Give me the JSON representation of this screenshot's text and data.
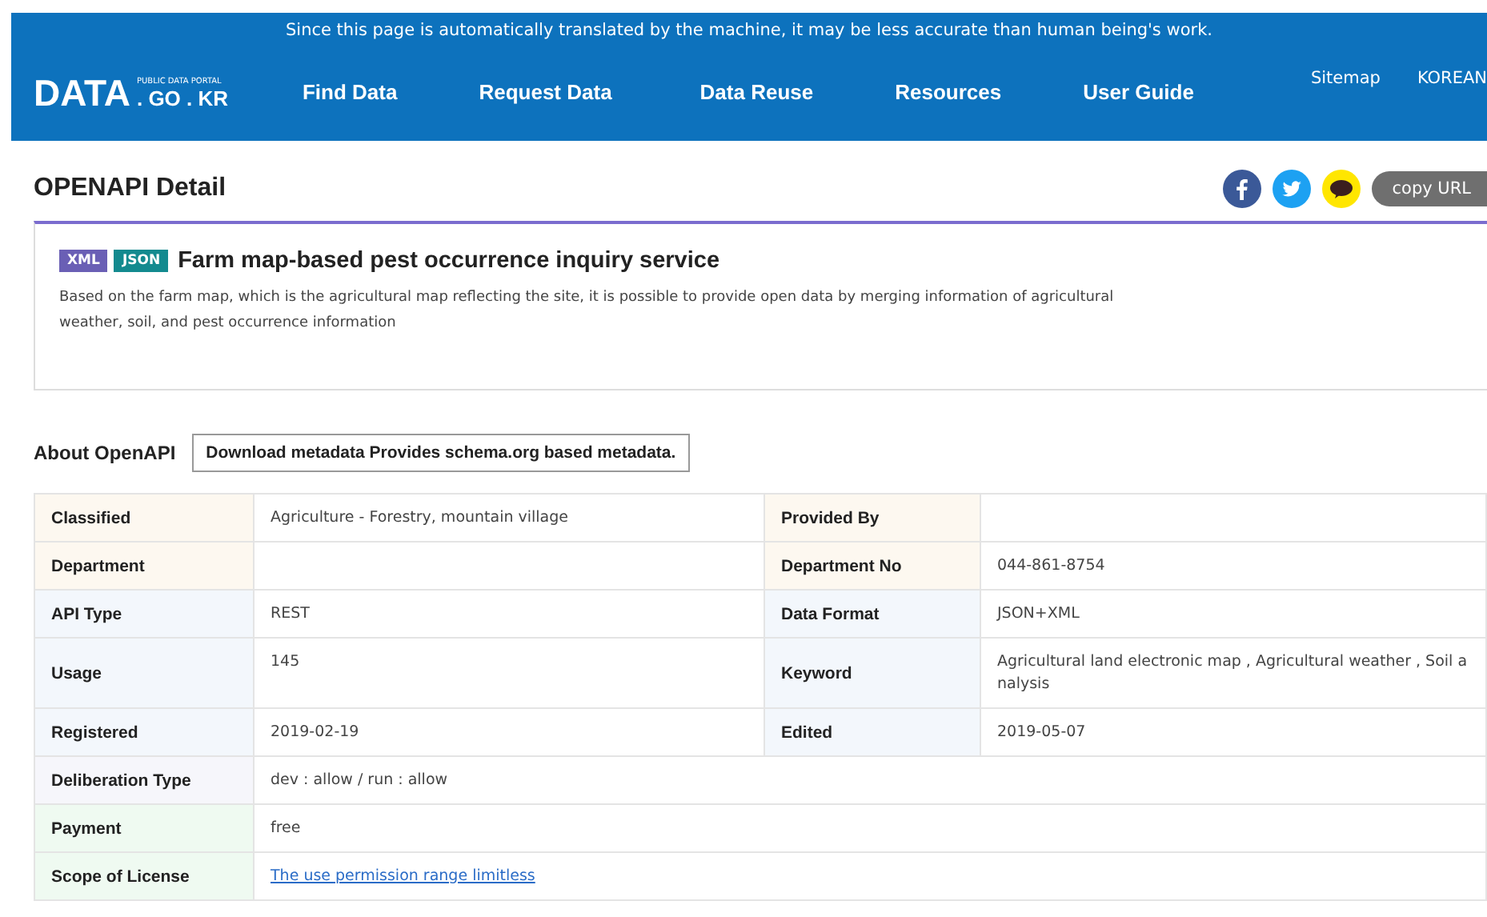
{
  "header": {
    "notice": "Since this page is automatically translated by the machine, it may be less accurate than human being's work.",
    "logo": {
      "main": "DATA",
      "sub": "PUBLIC DATA PORTAL",
      "domain": ". GO . KR"
    },
    "nav": [
      "Find Data",
      "Request Data",
      "Data Reuse",
      "Resources",
      "User Guide"
    ],
    "utility": [
      "Sitemap",
      "KOREAN"
    ]
  },
  "page_title": "OPENAPI Detail",
  "share": {
    "copy_label": "copy URL"
  },
  "service": {
    "formats": [
      {
        "label": "XML",
        "color": "#6a5fb5"
      },
      {
        "label": "JSON",
        "color": "#138a8f"
      }
    ],
    "title": "Farm map-based pest occurrence inquiry service",
    "description": "Based on the farm map, which is the agricultural map reflecting the site, it is possible to provide open data by merging information of agricultural weather, soil, and pest occurrence information"
  },
  "about": {
    "title": "About OpenAPI",
    "metadata_button": "Download metadata Provides schema.org based metadata."
  },
  "table": {
    "rows": [
      {
        "color": "#fdf8f0",
        "cells": [
          {
            "label": "Classified",
            "value": "Agriculture - Forestry, mountain village"
          },
          {
            "label": "Provided By"
          }
        ]
      },
      {
        "color": "#fdf8f0",
        "cells": [
          {
            "label": "Department"
          },
          {
            "label": "Department No",
            "value": "044-861-8754"
          }
        ]
      },
      {
        "color": "#f3f7fc",
        "cells": [
          {
            "label": "API Type",
            "value": "REST"
          },
          {
            "label": "Data Format",
            "value": "JSON+XML"
          }
        ]
      },
      {
        "color": "#f3f7fc",
        "tall": true,
        "cells": [
          {
            "label": "Usage",
            "value": "145"
          },
          {
            "label": "Keyword",
            "value": "Agricultural land electronic map , Agricultural weather , Soil a nalysis"
          }
        ]
      },
      {
        "color": "#f3f7fc",
        "cells": [
          {
            "label": "Registered",
            "value": "2019-02-19"
          },
          {
            "label": "Edited",
            "value": "2019-05-07"
          }
        ]
      },
      {
        "color": "#f6f6fb",
        "cells": [
          {
            "label": "Deliberation Type",
            "value": "dev : allow / run : allow"
          }
        ]
      },
      {
        "color": "#effaf1",
        "cells": [
          {
            "label": "Payment",
            "value": "free"
          }
        ]
      },
      {
        "color": "#effaf1",
        "cells": [
          {
            "label": "Scope of License",
            "value": "The use permission range limitless",
            "link": true
          }
        ]
      }
    ]
  }
}
